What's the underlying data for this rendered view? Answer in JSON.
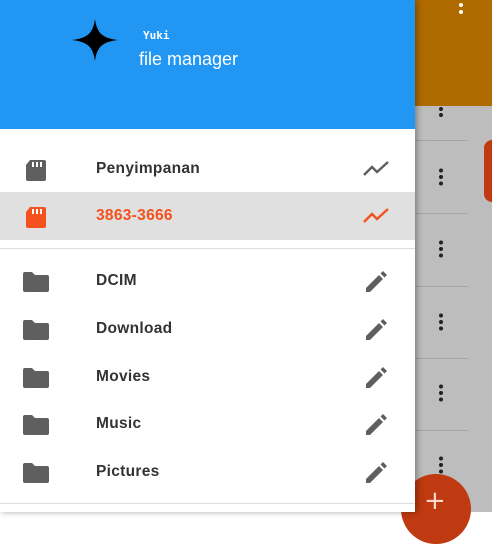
{
  "colors": {
    "header_blue": "#2196f3",
    "active_orange": "#f4511e",
    "icon_gray": "#5f5f5f",
    "background_app_bar": "#b06b00"
  },
  "header": {
    "logo_icon": "four-point-star-icon",
    "subtitle": "Yuki",
    "title": "file manager"
  },
  "storage": [
    {
      "label": "Penyimpanan",
      "icon": "sd-card-icon",
      "action_icon": "trending-chart-icon",
      "active": false
    },
    {
      "label": "3863-3666",
      "icon": "sd-card-icon",
      "action_icon": "trending-chart-icon",
      "active": true
    }
  ],
  "folders": [
    {
      "label": "DCIM",
      "icon": "folder-icon",
      "action_icon": "pencil-icon"
    },
    {
      "label": "Download",
      "icon": "folder-icon",
      "action_icon": "pencil-icon"
    },
    {
      "label": "Movies",
      "icon": "folder-icon",
      "action_icon": "pencil-icon"
    },
    {
      "label": "Music",
      "icon": "folder-icon",
      "action_icon": "pencil-icon"
    },
    {
      "label": "Pictures",
      "icon": "folder-icon",
      "action_icon": "pencil-icon"
    }
  ],
  "background_app": {
    "overflow_icon": "more-vert-icon",
    "row_menu_icon": "more-vert-icon",
    "fab_icon": "plus-icon",
    "fab_label": "+"
  }
}
